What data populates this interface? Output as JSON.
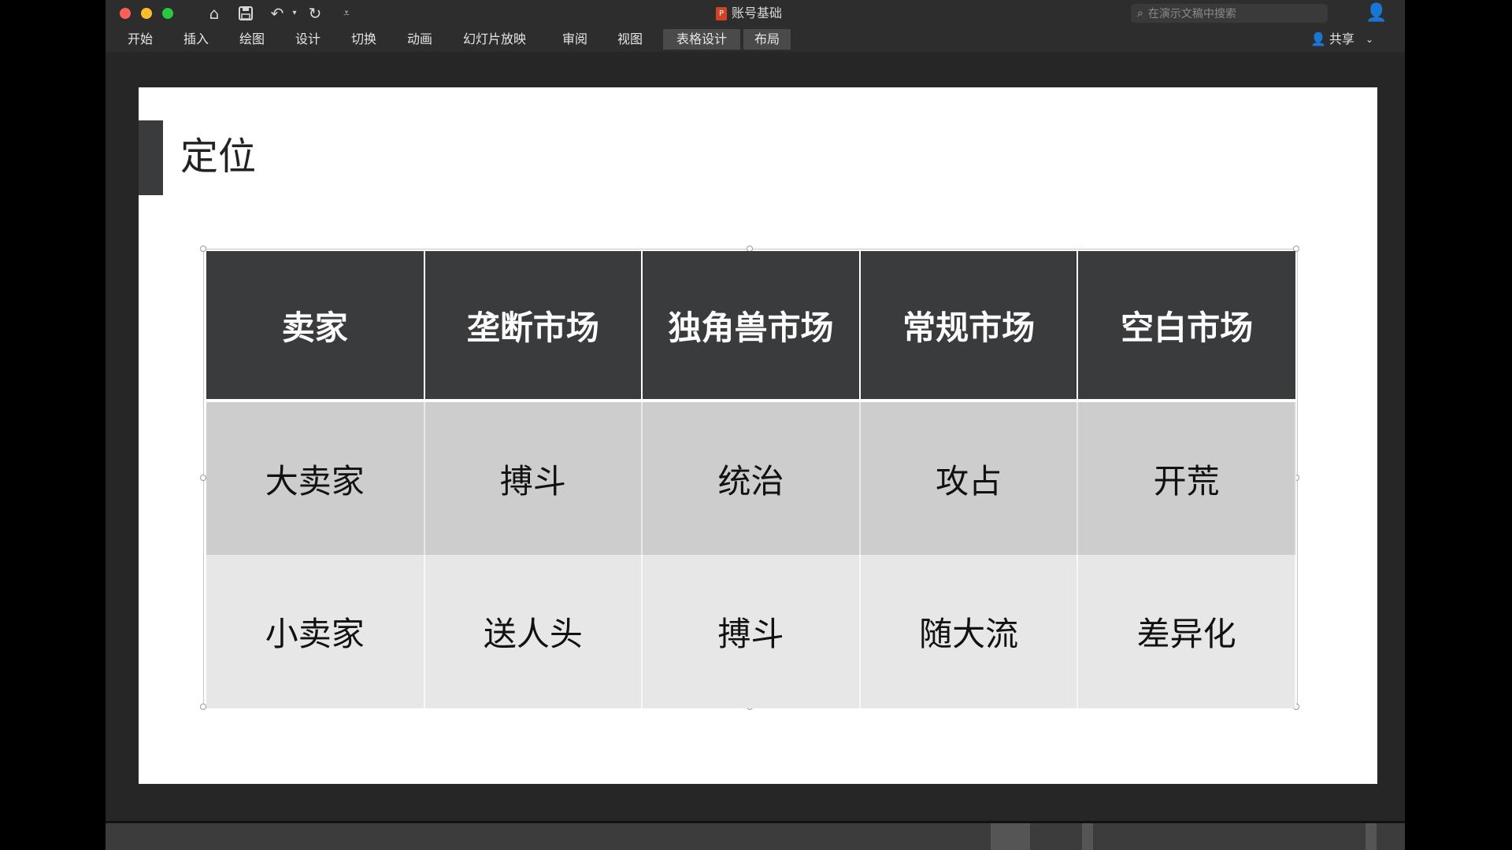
{
  "window": {
    "doc_title": "账号基础",
    "search_placeholder": "在演示文稿中搜索",
    "share_label": "共享"
  },
  "ribbon": {
    "tabs": [
      "开始",
      "插入",
      "绘图",
      "设计",
      "切换",
      "动画",
      "幻灯片放映",
      "审阅",
      "视图",
      "表格设计",
      "布局"
    ],
    "active_tabs": [
      "表格设计",
      "布局"
    ]
  },
  "slide": {
    "title": "定位",
    "table": {
      "headers": [
        "卖家",
        "垄断市场",
        "独角兽市场",
        "常规市场",
        "空白市场"
      ],
      "rows": [
        [
          "大卖家",
          "搏斗",
          "统治",
          "攻占",
          "开荒"
        ],
        [
          "小卖家",
          "送人头",
          "搏斗",
          "随大流",
          "差异化"
        ]
      ]
    }
  },
  "colors": {
    "header_bg": "#3a3b3d",
    "row1_bg": "#cdcdcd",
    "row2_bg": "#e7e7e7",
    "accent_bar": "#3a3b3d"
  }
}
